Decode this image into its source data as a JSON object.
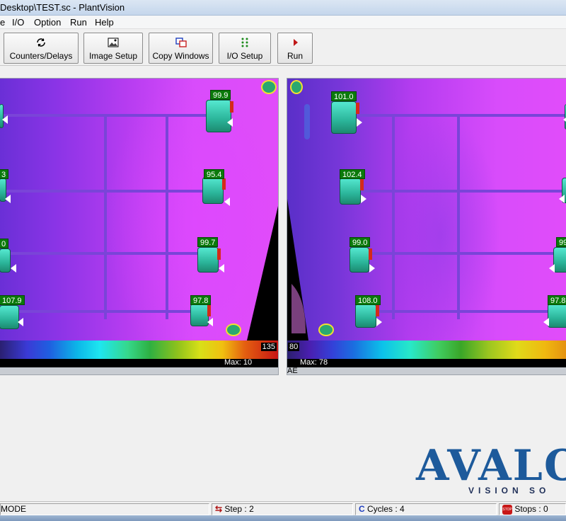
{
  "window": {
    "title": "Desktop\\TEST.sc - PlantVision"
  },
  "menu": {
    "items": [
      "e",
      "I/O",
      "Option",
      "Run",
      "Help"
    ]
  },
  "toolbar": {
    "buttons": [
      {
        "label": "Counters/Delays",
        "icon": "refresh-icon"
      },
      {
        "label": "Image Setup",
        "icon": "image-setup-icon"
      },
      {
        "label": "Copy Windows",
        "icon": "copy-windows-icon"
      },
      {
        "label": "I/O Setup",
        "icon": "io-setup-icon"
      },
      {
        "label": "Run",
        "icon": "run-icon"
      }
    ]
  },
  "left_pane": {
    "readings": [
      "99.9",
      "95.4",
      "99.7",
      "97.8",
      "107.9",
      "0",
      "3"
    ],
    "colorbar_max": "135",
    "strip_text": "Max: 10"
  },
  "right_pane": {
    "readings": [
      "101.0",
      "102.4",
      "99.0",
      "108.0",
      "97.8",
      "99"
    ],
    "colorbar_min": "80",
    "strip_text": "Max: 78",
    "caption": "AE"
  },
  "logo": {
    "text": "AVALO",
    "subtext": "VISION SO"
  },
  "status": {
    "mode": "MODE",
    "step": "Step : 2",
    "cycles": "Cycles : 4",
    "stops": "Stops : 0"
  },
  "colors": {
    "title_bar": "#c4d6ec",
    "logo": "#1d5a9b",
    "reading_label": "#0b7a0b"
  }
}
